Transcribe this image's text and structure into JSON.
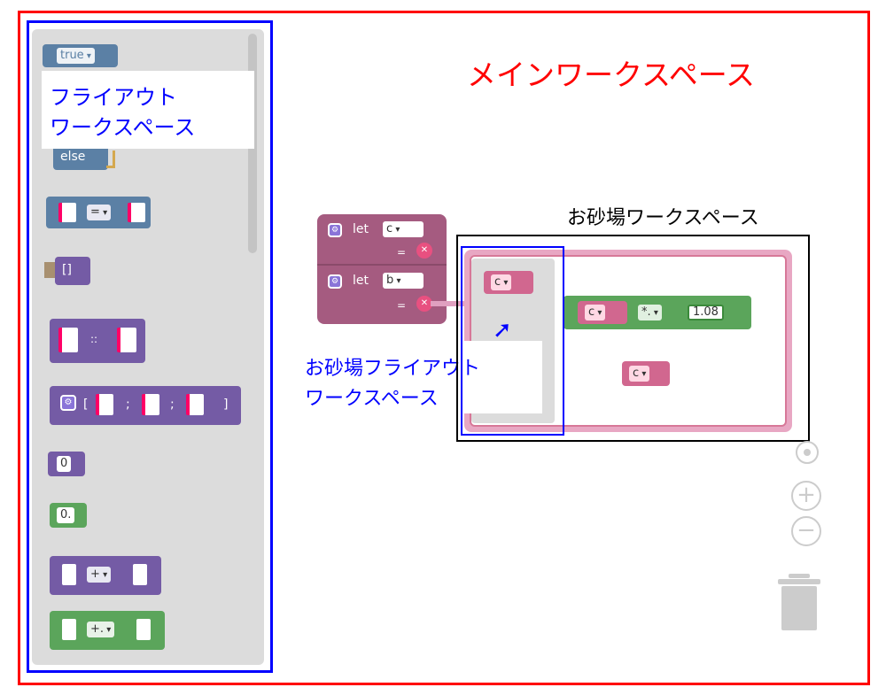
{
  "labels": {
    "main_workspace": "メインワークスペース",
    "flyout_workspace_line1": "フライアウト",
    "flyout_workspace_line2": "ワークスペース",
    "sandbox_workspace": "お砂場ワークスペース",
    "sandbox_flyout_line1": "お砂場フライアウト",
    "sandbox_flyout_line2": "ワークスペース"
  },
  "flyout_blocks": {
    "true_dropdown": "true",
    "else_label": "else",
    "equals_op": "=",
    "list_brackets": "[]",
    "cons_op": "::",
    "array_open": "[",
    "array_sep1": ";",
    "array_sep2": ";",
    "array_close": "]",
    "int_value": "0",
    "float_value": "0.",
    "plus_op": "+",
    "float_plus_op": "+."
  },
  "main_blocks": {
    "let1_keyword": "let",
    "let1_var": "c",
    "let1_eq": "=",
    "let2_keyword": "let",
    "let2_var": "b",
    "let2_eq": "="
  },
  "sandbox_blocks": {
    "flyout_var": "c",
    "expr_var": "c",
    "expr_op": "*.",
    "expr_value": "1.08",
    "loose_var": "c"
  },
  "colors": {
    "main_frame": "#ff0000",
    "flyout_frame": "#0000ff",
    "sandbox_frame": "#000000",
    "main_label": "#ff0000",
    "blue_label": "#0000ff"
  },
  "icons": [
    "target-icon",
    "zoom-in-icon",
    "zoom-out-icon",
    "trash-icon",
    "gear-icon",
    "arrow-icon"
  ]
}
